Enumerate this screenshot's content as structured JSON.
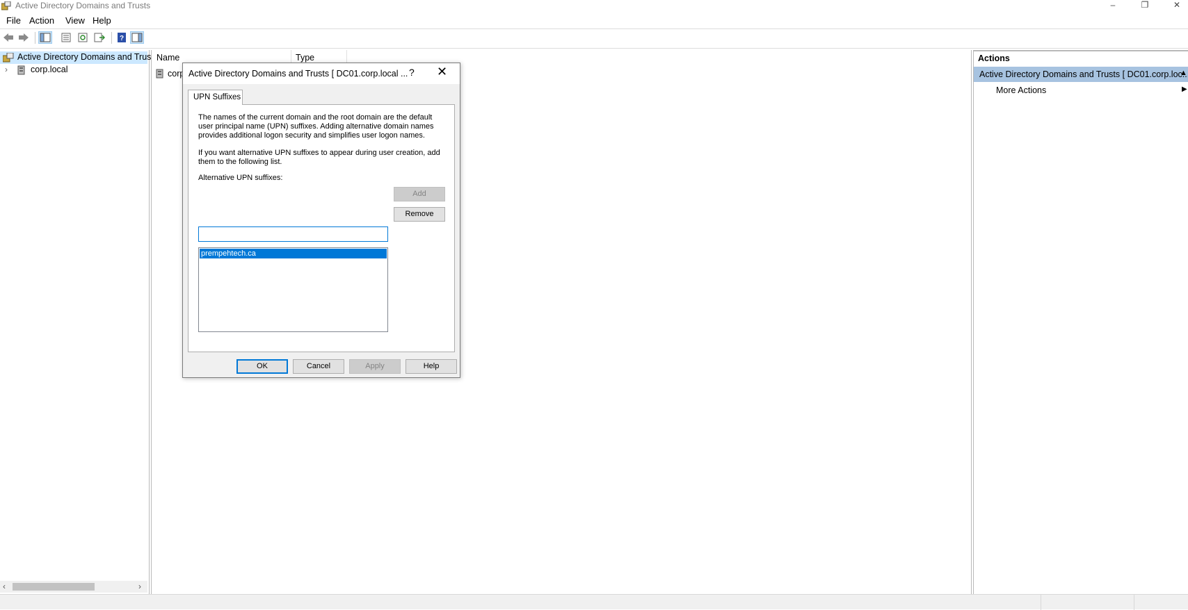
{
  "window": {
    "title": "Active Directory Domains and Trusts",
    "minimize": "–",
    "restore": "❐",
    "close": "✕"
  },
  "menu": [
    "File",
    "Action",
    "View",
    "Help"
  ],
  "toolbar": {
    "icons": [
      "back-icon",
      "forward-icon",
      "show-hide-tree-icon",
      "properties-icon",
      "refresh-icon",
      "export-list-icon",
      "help-icon",
      "show-hide-action-pane-icon"
    ]
  },
  "tree": {
    "root": "Active Directory Domains and Trusts",
    "child": "corp.local"
  },
  "list": {
    "columns": [
      "Name",
      "Type"
    ],
    "rows": [
      {
        "name": "corp",
        "type": ""
      }
    ]
  },
  "actions": {
    "title": "Actions",
    "section": "Active Directory Domains and Trusts [ DC01.corp.loc...",
    "more": "More Actions"
  },
  "dialog": {
    "title": "Active Directory Domains and Trusts [ DC01.corp.local ...",
    "help": "?",
    "close": "✕",
    "tab": "UPN Suffixes",
    "para1": "The names of the current domain and the root domain are the default user principal name (UPN) suffixes. Adding alternative domain names provides additional logon security and simplifies user logon names.",
    "para2": "If you want alternative UPN suffixes to appear during user creation, add them to the following list.",
    "field_label": "Alternative UPN suffixes:",
    "field_value": "",
    "add": "Add",
    "remove": "Remove",
    "suffixes": [
      "prempehtech.ca"
    ],
    "ok": "OK",
    "cancel": "Cancel",
    "apply": "Apply",
    "help_btn": "Help"
  },
  "colors": {
    "selection": "#0078d7",
    "tree_selected": "#cce8ff",
    "actions_section": "#a7c3e0"
  }
}
